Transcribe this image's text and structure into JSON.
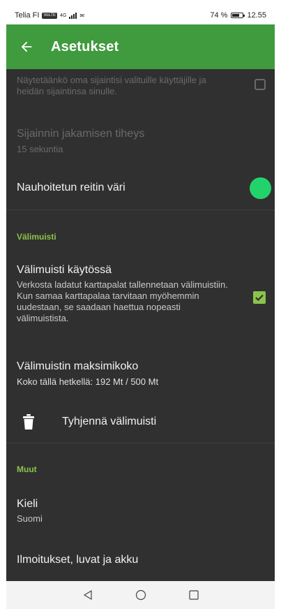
{
  "status_bar": {
    "carrier": "Telia FI",
    "network_badge": "VoLTE",
    "signal_type": "4G",
    "battery_percent_text": "74 %",
    "battery_level": 0.74,
    "time": "12.55"
  },
  "app_bar": {
    "back_icon": "arrow-left-icon",
    "title": "Asetukset"
  },
  "settings": {
    "share_location": {
      "description": "Näytetäänkö oma sijaintisi valituille käyttäjille ja heidän sijaintinsa sinulle.",
      "checked": false,
      "enabled": false
    },
    "share_frequency": {
      "title": "Sijainnin jakamisen tiheys",
      "value": "15 sekuntia",
      "enabled": false
    },
    "route_color": {
      "title": "Nauhoitetun reitin väri",
      "color": "#22d36b"
    },
    "cache_section": {
      "label": "Välimuisti"
    },
    "cache_enabled": {
      "title": "Välimuisti käytössä",
      "description": "Verkosta ladatut karttapalat tallennetaan välimuistiin. Kun samaa karttapalaa tarvitaan myöhemmin uudestaan, se saadaan haettua nopeasti välimuistista.",
      "checked": true
    },
    "cache_max_size": {
      "title": "Välimuistin maksimikoko",
      "value": "Koko tällä hetkellä: 192 Mt / 500 Mt"
    },
    "clear_cache": {
      "icon": "trash-icon",
      "label": "Tyhjennä välimuisti"
    },
    "other_section": {
      "label": "Muut"
    },
    "language": {
      "title": "Kieli",
      "value": "Suomi"
    },
    "notifications": {
      "title": "Ilmoitukset, luvat ja akku"
    }
  },
  "nav_bar": {
    "back": "triangle-back-icon",
    "home": "circle-home-icon",
    "recents": "square-recents-icon"
  },
  "colors": {
    "accent": "#3f9b3d",
    "section": "#8bc34a",
    "background": "#303030"
  }
}
